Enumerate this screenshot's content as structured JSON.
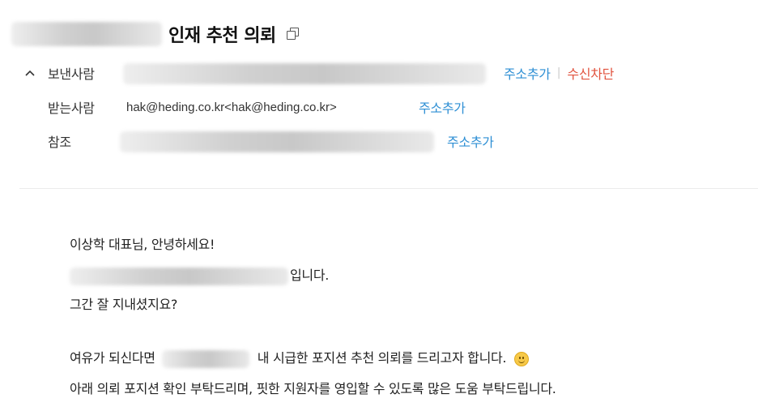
{
  "email": {
    "subject": "인재 추천 의뢰",
    "header": {
      "sender": {
        "label": "보낸사람",
        "add_label": "주소추가",
        "block_label": "수신차단"
      },
      "to": {
        "label": "받는사람",
        "address": "hak@heding.co.kr<hak@heding.co.kr>",
        "add_label": "주소추가"
      },
      "cc": {
        "label": "참조",
        "add_label": "주소추가"
      }
    },
    "body": {
      "greeting": "이상학 대표님, 안녕하세요!",
      "intro_suffix": "입니다.",
      "line3": "그간 잘 지내셨지요?",
      "line4_prefix": "여유가 되신다면",
      "line4_suffix": "내 시급한 포지션 추천 의뢰를 드리고자 합니다.",
      "line5": "아래 의뢰 포지션 확인 부탁드리며, 핏한 지원자를 영입할 수 있도록 많은 도움 부탁드립니다."
    }
  },
  "icons": [
    "copy-icon",
    "chevron-up-icon",
    "smiley-emoji-icon"
  ],
  "colors": {
    "link": "#2e8fd4",
    "block": "#e1533f",
    "divider": "#ececec"
  }
}
